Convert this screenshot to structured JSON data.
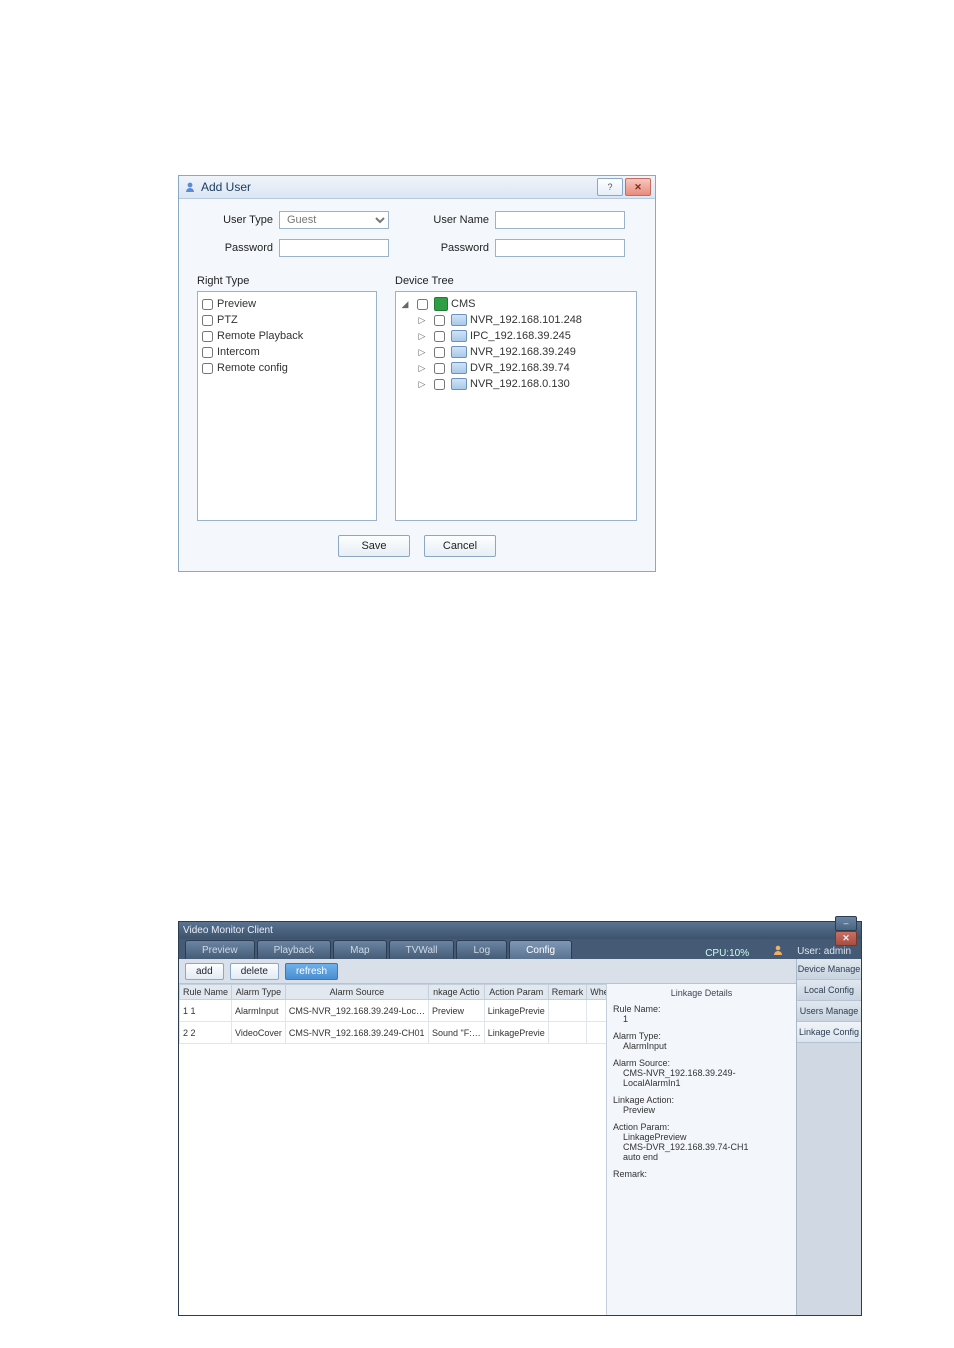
{
  "dialog_add_user": {
    "title": "Add User",
    "labels": {
      "user_type": "User Type",
      "user_name": "User Name",
      "password1": "Password",
      "password2": "Password",
      "right_type": "Right Type",
      "device_tree": "Device Tree"
    },
    "user_type_value": "Guest",
    "user_name_value": "",
    "password1_value": "",
    "password2_value": "",
    "rights": [
      "Preview",
      "PTZ",
      "Remote Playback",
      "Intercom",
      "Remote config"
    ],
    "tree_root": "CMS",
    "tree_children": [
      "NVR_192.168.101.248",
      "IPC_192.168.39.245",
      "NVR_192.168.39.249",
      "DVR_192.168.39.74",
      "NVR_192.168.0.130"
    ],
    "buttons": {
      "save": "Save",
      "cancel": "Cancel"
    }
  },
  "app_vmc": {
    "title": "Video Monitor Client",
    "tabs": [
      "Preview",
      "Playback",
      "Map",
      "TVWall",
      "Log",
      "Config"
    ],
    "cpu": "CPU:10%",
    "user_label": "User: admin",
    "toolbar": {
      "add": "add",
      "delete": "delete",
      "refresh": "refresh"
    },
    "side_items": [
      "Device Manage",
      "Local Config",
      "Users Manage",
      "Linkage Config"
    ],
    "table": {
      "headers": [
        "Rule Name",
        "Alarm Type",
        "Alarm Source",
        "nkage Actio",
        "Action Param",
        "Remark",
        "Whether Enable"
      ],
      "rows": [
        {
          "name": "1 1",
          "type": "AlarmInput",
          "source": "CMS-NVR_192.168.39.249-Loc…",
          "action": "Preview",
          "param": "LinkagePrevie",
          "remark": "",
          "enable": true
        },
        {
          "name": "2 2",
          "type": "VideoCover",
          "source": "CMS-NVR_192.168.39.249-CH01",
          "action": "Sound \"F:…",
          "param": "LinkagePrevie",
          "remark": "",
          "enable": true
        }
      ]
    },
    "details": {
      "title": "Linkage Details",
      "rule_name_k": "Rule Name:",
      "rule_name_v": "1",
      "alarm_type_k": "Alarm Type:",
      "alarm_type_v": "AlarmInput",
      "alarm_source_k": "Alarm Source:",
      "alarm_source_v": "CMS-NVR_192.168.39.249-LocalAlarmIn1",
      "linkage_action_k": "Linkage Action:",
      "linkage_action_v": "Preview",
      "action_param_k": "Action Param:",
      "action_param_v": "LinkagePreview\n    CMS-DVR_192.168.39.74-CH1\n    auto end",
      "remark_k": "Remark:",
      "remark_v": ""
    }
  }
}
